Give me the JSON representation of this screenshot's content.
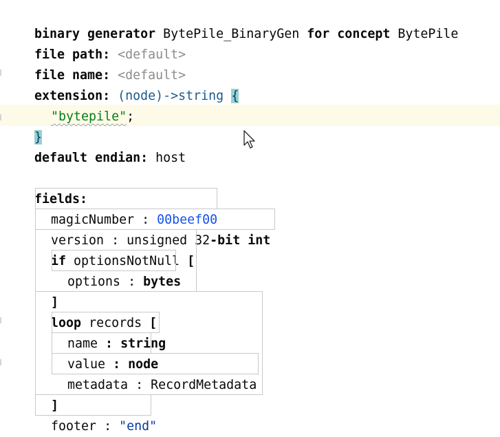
{
  "header": {
    "kw_binary_generator": "binary generator",
    "generator_name": "BytePile_BinaryGen",
    "kw_for_concept": "for concept",
    "concept_name": "BytePile"
  },
  "file_path": {
    "label": "file path:",
    "value": "<default>"
  },
  "file_name": {
    "label": "file name:",
    "value": "<default>"
  },
  "extension": {
    "label": "extension:",
    "signature": "(node)->string",
    "open_brace": "{",
    "body_string": "\"bytepile\"",
    "semicolon": ";",
    "close_brace": "}"
  },
  "default_endian": {
    "label": "default endian:",
    "value": "host"
  },
  "fields": {
    "label": "fields:",
    "magic": {
      "name": "magicNumber",
      "sep": " : ",
      "value": "00beef00"
    },
    "version": {
      "name": "version",
      "sep": " : ",
      "type_plain": "unsigned 32",
      "type_bold": "-bit int"
    },
    "if_block": {
      "kw_if": "if",
      "condition": "optionsNotNull",
      "open": "[",
      "close": "]",
      "options": {
        "name": "options",
        "sep": " : ",
        "type": "bytes"
      }
    },
    "loop_block": {
      "kw_loop": "loop",
      "name": "records",
      "open": "[",
      "close": "]",
      "items": [
        {
          "name": "name",
          "sep": " : ",
          "type": "string"
        },
        {
          "name": "value",
          "sep": " : ",
          "type": "node"
        },
        {
          "name": "metadata",
          "sep": " : ",
          "type": "RecordMetadata"
        }
      ]
    },
    "footer": {
      "name": "footer",
      "sep": " : ",
      "value": "\"end\""
    }
  }
}
